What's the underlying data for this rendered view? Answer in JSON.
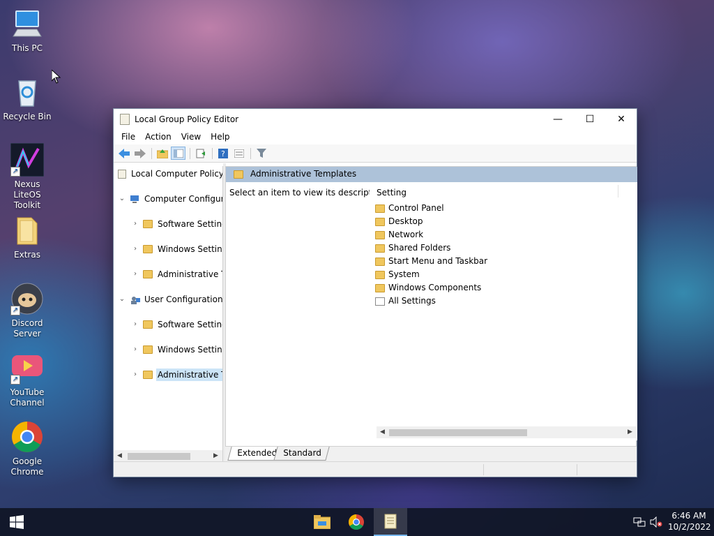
{
  "desktop": {
    "icons": [
      {
        "label": "This PC",
        "icon": "computer-icon"
      },
      {
        "label": "Recycle Bin",
        "icon": "recycle-bin-icon"
      },
      {
        "label": "Nexus LiteOS Toolkit",
        "icon": "nexus-toolkit-icon"
      },
      {
        "label": "Extras",
        "icon": "folder-icon"
      },
      {
        "label": "Discord Server",
        "icon": "discord-icon"
      },
      {
        "label": "YouTube Channel",
        "icon": "youtube-icon"
      },
      {
        "label": "Google Chrome",
        "icon": "chrome-icon"
      }
    ]
  },
  "window": {
    "title": "Local Group Policy Editor",
    "controls": {
      "minimize": "—",
      "maximize": "☐",
      "close": "✕"
    },
    "menu": [
      "File",
      "Action",
      "View",
      "Help"
    ],
    "toolbar": [
      "back-icon",
      "forward-icon",
      "up-folder-icon",
      "show-hide-tree-icon",
      "export-list-icon",
      "help-icon",
      "properties-icon",
      "filter-icon"
    ],
    "tree": {
      "root": "Local Computer Policy",
      "items": [
        {
          "label": "Computer Configura",
          "level": 1,
          "expander": "⌄"
        },
        {
          "label": "Software Settings",
          "level": 2,
          "expander": "›"
        },
        {
          "label": "Windows Setting",
          "level": 2,
          "expander": "›"
        },
        {
          "label": "Administrative Te",
          "level": 2,
          "expander": "›"
        },
        {
          "label": "User Configuration",
          "level": 1,
          "expander": "⌄"
        },
        {
          "label": "Software Settings",
          "level": 2,
          "expander": "›"
        },
        {
          "label": "Windows Setting",
          "level": 2,
          "expander": "›"
        },
        {
          "label": "Administrative Te",
          "level": 2,
          "expander": "›",
          "selected": true
        }
      ]
    },
    "content": {
      "header": "Administrative Templates",
      "description": "Select an item to view its description.",
      "column_header": "Setting",
      "items": [
        "Control Panel",
        "Desktop",
        "Network",
        "Shared Folders",
        "Start Menu and Taskbar",
        "System",
        "Windows Components",
        "All Settings"
      ]
    },
    "tabs": [
      "Extended",
      "Standard"
    ]
  },
  "taskbar": {
    "start": "windows-start-icon",
    "apps": [
      "file-explorer-icon",
      "chrome-icon",
      "group-policy-editor-icon"
    ],
    "tray": {
      "network": "network-icon",
      "volume": "volume-muted-icon"
    },
    "time": "6:46 AM",
    "date": "10/2/2022"
  },
  "colors": {
    "selection": "#cce4f7",
    "header_band": "#adc2d9",
    "taskbar": "#101626"
  }
}
